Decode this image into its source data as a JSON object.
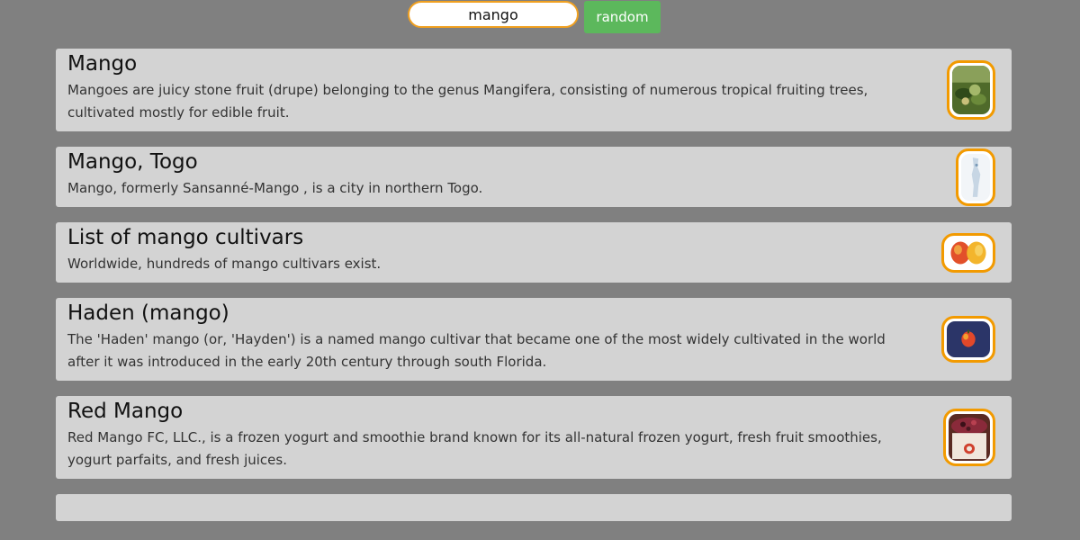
{
  "search": {
    "value": "mango",
    "button_label": "random"
  },
  "results": [
    {
      "title": "Mango",
      "description": "Mangoes are juicy stone fruit (drupe) belonging to the genus Mangifera, consisting of numerous tropical fruiting trees, cultivated mostly for edible fruit.",
      "icon": "mango-tree-image"
    },
    {
      "title": "Mango, Togo",
      "description": "Mango, formerly Sansanné-Mango , is a city in northern Togo.",
      "icon": "togo-map-image"
    },
    {
      "title": "List of mango cultivars",
      "description": "Worldwide, hundreds of mango cultivars exist.",
      "icon": "mango-fruits-image"
    },
    {
      "title": "Haden (mango)",
      "description": "The 'Haden' mango (or, 'Hayden') is a named mango cultivar that became one of the most widely cultivated in the world after it was introduced in the early 20th century through south Florida.",
      "icon": "haden-mango-image"
    },
    {
      "title": "Red Mango",
      "description": "Red Mango FC, LLC., is a frozen yogurt and smoothie brand known for its all-natural frozen yogurt, fresh fruit smoothies, yogurt parfaits, and fresh juices.",
      "icon": "red-mango-cup-image"
    }
  ],
  "colors": {
    "background": "#808080",
    "card": "#d3d3d3",
    "accent_border": "#f29a00",
    "button": "#5cb85c"
  }
}
